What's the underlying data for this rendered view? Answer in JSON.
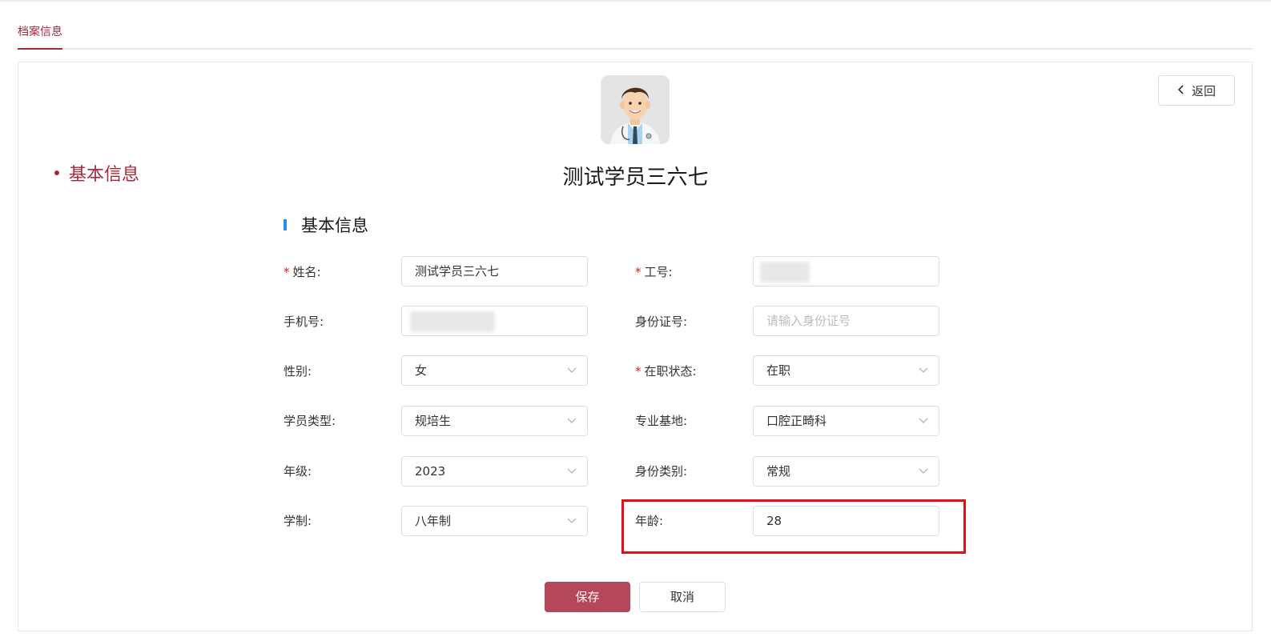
{
  "tabs": [
    {
      "label": "档案信息"
    }
  ],
  "side_nav": {
    "item": "基本信息"
  },
  "back_button": {
    "label": "返回"
  },
  "person": {
    "name": "测试学员三六七"
  },
  "section": {
    "title": "基本信息"
  },
  "form": {
    "name": {
      "label": "姓名:",
      "required": "*",
      "value": "测试学员三六七"
    },
    "job_no": {
      "label": "工号:",
      "required": "*",
      "value": ""
    },
    "phone": {
      "label": "手机号:",
      "value": ""
    },
    "id_card": {
      "label": "身份证号:",
      "placeholder": "请输入身份证号"
    },
    "gender": {
      "label": "性别:",
      "value": "女"
    },
    "employment_status": {
      "label": "在职状态:",
      "required": "*",
      "value": "在职"
    },
    "student_type": {
      "label": "学员类型:",
      "value": "规培生"
    },
    "base": {
      "label": "专业基地:",
      "value": "口腔正畸科"
    },
    "grade": {
      "label": "年级:",
      "value": "2023"
    },
    "identity_type": {
      "label": "身份类别:",
      "value": "常规"
    },
    "program_length": {
      "label": "学制:",
      "value": "八年制"
    },
    "age": {
      "label": "年龄:",
      "value": "28"
    }
  },
  "buttons": {
    "save": "保存",
    "cancel": "取消"
  },
  "colors": {
    "accent": "#a8283a",
    "save_button": "#b5475a",
    "section_bar": "#2d8cf0",
    "highlight": "#e0101a"
  }
}
